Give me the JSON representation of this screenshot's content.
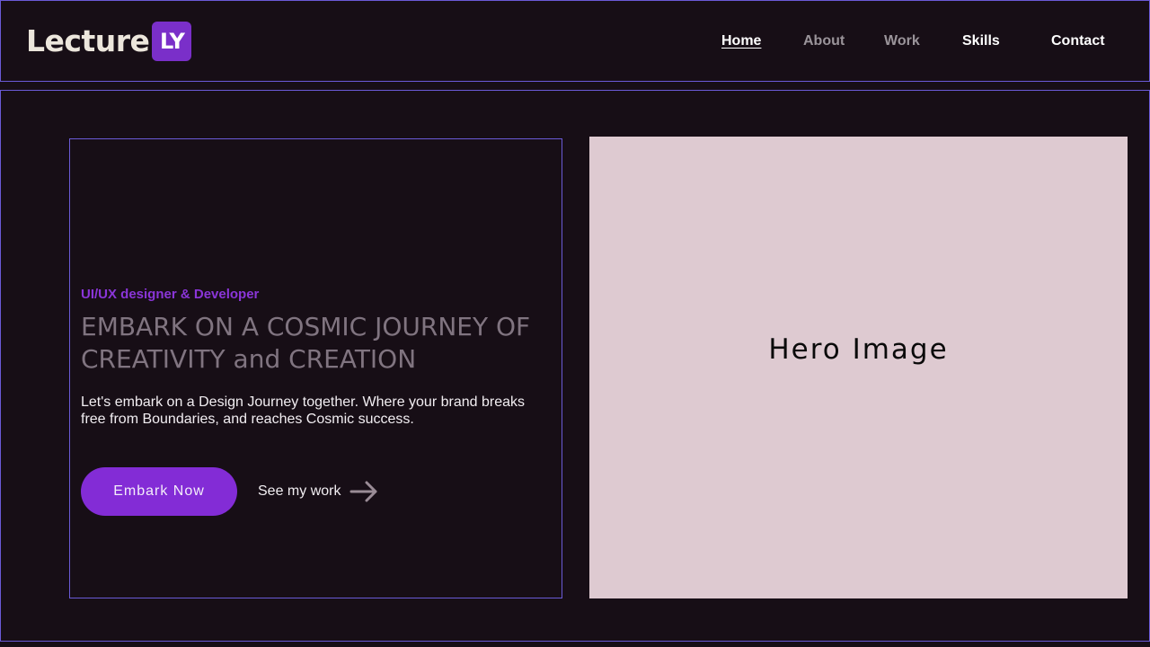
{
  "brand": {
    "name": "Lecture",
    "badge": "LY",
    "badge_color": "#7a2fc9"
  },
  "nav": {
    "items": [
      {
        "label": "Home",
        "state": "active"
      },
      {
        "label": "About",
        "state": "muted"
      },
      {
        "label": "Work",
        "state": "muted"
      },
      {
        "label": "Skills",
        "state": "default"
      },
      {
        "label": "Contact",
        "state": "default"
      }
    ]
  },
  "hero": {
    "eyebrow": "UI/UX designer & Developer",
    "headline": "EMBARK ON A COSMIC JOURNEY OF CREATIVITY and CREATION",
    "subtext": "Let's embark on a Design Journey together. Where your brand breaks free from Boundaries, and reaches Cosmic success.",
    "primary_button": "Embark Now",
    "secondary_link": "See my work",
    "secondary_icon": "arrow-right-icon",
    "image_placeholder": "Hero Image"
  },
  "colors": {
    "background": "#170e16",
    "accent": "#832cd6",
    "outline": "#6a5ad6",
    "image_placeholder_bg": "#decad1"
  }
}
